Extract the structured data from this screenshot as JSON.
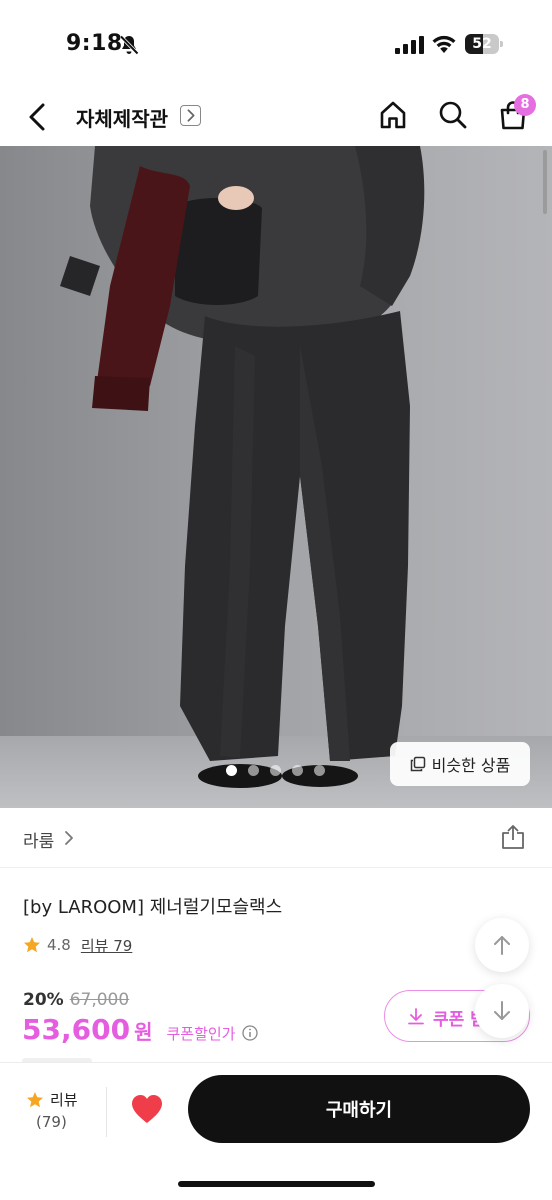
{
  "status_bar": {
    "time": "9:18",
    "battery": "52",
    "battery_level": 0.52,
    "icons": [
      "bell-slash-icon",
      "signal-icon",
      "wifi-icon",
      "battery-icon"
    ]
  },
  "nav": {
    "title": "자체제작관",
    "cart_count": "8",
    "icons": [
      "back-icon",
      "chevron-right-icon",
      "home-icon",
      "search-icon",
      "shopping-bag-icon"
    ]
  },
  "hero": {
    "carousel_total": 5,
    "carousel_active": 1,
    "similar_button_label": "비슷한 상품"
  },
  "brand": {
    "name": "라룸"
  },
  "product": {
    "title": "[by LAROOM] 제너럴기모슬랙스",
    "rating": "4.8",
    "review_link": "리뷰 79",
    "discount_rate": "20%",
    "original_price": "67,000",
    "sale_price": "53,600",
    "currency": "원",
    "coupon_note": "쿠폰할인가",
    "coupon_button_label": "쿠폰 받"
  },
  "bottom_bar": {
    "review_label": "리뷰",
    "review_count": "(79)",
    "buy_label": "구매하기"
  },
  "colors": {
    "accent_pink": "#e55ee0",
    "badge_pink": "#e56ee0",
    "heart_red": "#ef3e4a",
    "star_gold": "#f5a623",
    "buy_button": "#111111"
  }
}
